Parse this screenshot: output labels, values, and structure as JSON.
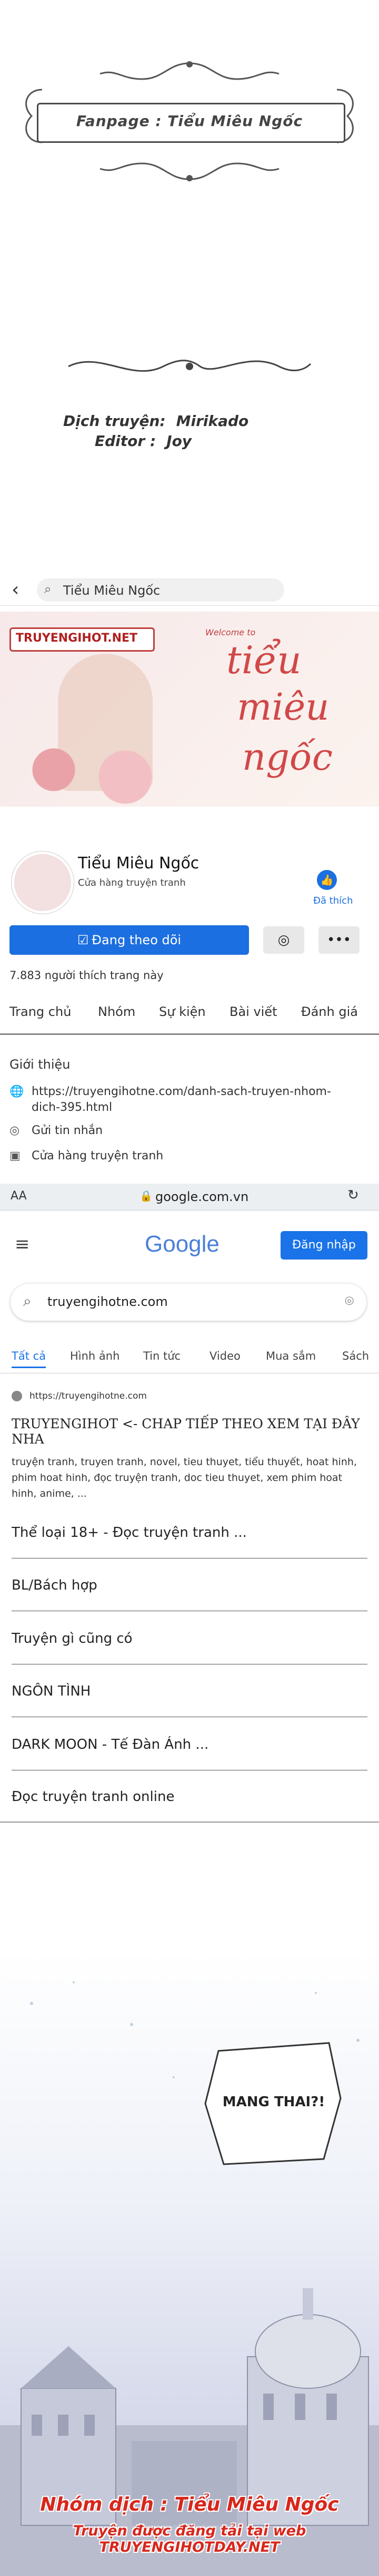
{
  "intro": {
    "fanpage": "Fanpage : Tiểu Miêu Ngốc",
    "translator_label": "Dịch truyện:",
    "translator_value": "Mirikado",
    "editor_label": "Editor :",
    "editor_value": "Joy"
  },
  "facebook": {
    "search_text": "Tiểu Miêu Ngốc",
    "cover_banner_label": "TRUYENGIHOT.NET",
    "cover_small": "Welcome to",
    "cover_title_1": "tiểu",
    "cover_title_2": "miêu",
    "cover_title_3": "ngốc",
    "page_name": "Tiểu Miêu Ngốc",
    "page_category": "Cửa hàng truyện tranh",
    "like_label": "Đã thích",
    "follow_label": "Đang theo dõi",
    "more_label": "•••",
    "likes_count": "7.883 người thích trang này",
    "tabs": [
      "Trang chủ",
      "Nhóm",
      "Sự kiện",
      "Bài viết",
      "Đánh giá"
    ],
    "about_title": "Giới thiệu",
    "link_line1": "https://truyengihotne.com/danh-sach-truyen-nhom-",
    "link_line2": "dich-395.html",
    "message_label": "Gửi tin nhắn",
    "category_label": "Cửa hàng truyện tranh"
  },
  "google": {
    "aa": "AA",
    "url": "google.com.vn",
    "logo": "Google",
    "login": "Đăng nhập",
    "query": "truyengihotne.com",
    "tabs": [
      "Tất cả",
      "Hình ảnh",
      "Tin tức",
      "Video",
      "Mua sắm",
      "Sách"
    ],
    "result_url": "https://truyengihotne.com",
    "result_title": "TRUYENGIHOT <- CHAP TIẾP THEO XEM TẠI ĐÂY NHA",
    "result_desc": "truyện tranh, truyen tranh, novel, tieu thuyet, tiểu thuyết, hoat hinh, phim hoat hinh, đọc truyện tranh, doc tieu thuyet, xem phim hoat hinh, anime, ...",
    "links": [
      "Thể loại 18+ - Đọc truyện tranh ...",
      "BL/Bách hợp",
      "Truyện gì cũng có",
      "NGÔN TÌNH",
      "DARK MOON - Tế Đàn Ánh ...",
      "Đọc truyện tranh online"
    ]
  },
  "manga": {
    "bubble": "MANG THAI?!",
    "credit1": "Nhóm dịch : Tiểu Miêu Ngốc",
    "credit2": "Truyện được đăng tải tại web TRUYENGIHOTDAY.NET"
  },
  "colors": {
    "fb_blue": "#1c6fe0",
    "google_blue": "#1a73e8",
    "credit_red": "#d8271c"
  }
}
